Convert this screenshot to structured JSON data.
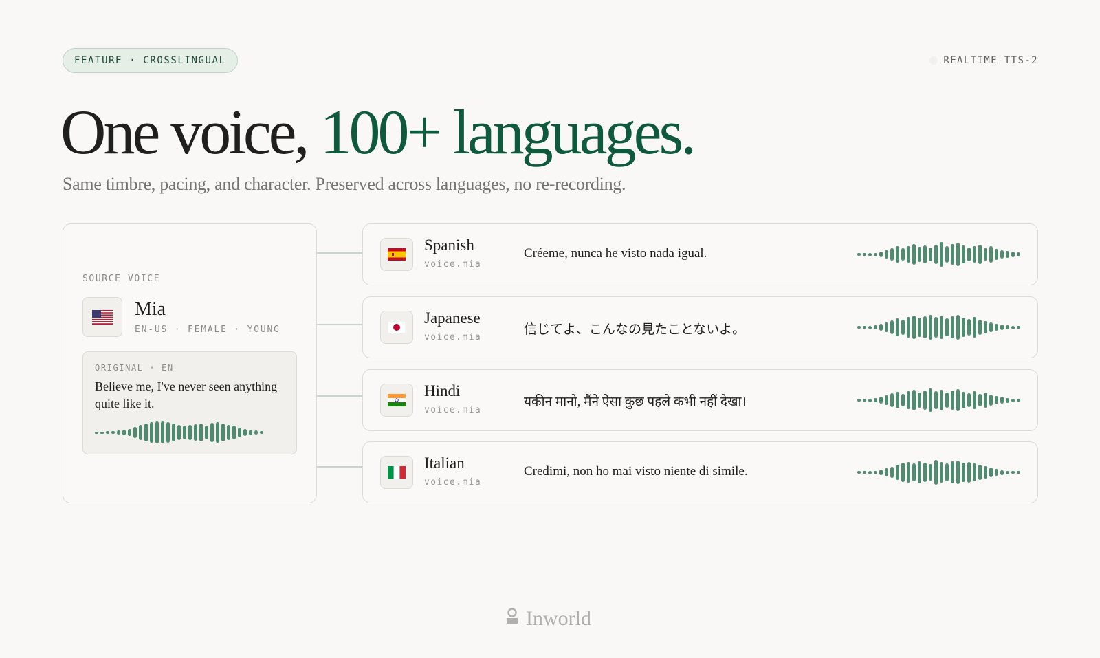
{
  "badge": "FEATURE · CROSSLINGUAL",
  "model_tag": "REALTIME TTS-2",
  "headline": {
    "part1": "One voice,",
    "part2": "100+ languages."
  },
  "subhead": "Same timbre, pacing, and character. Preserved across languages, no re-recording.",
  "source": {
    "label": "SOURCE VOICE",
    "flag_icon": "us-flag-icon",
    "name": "Mia",
    "meta": "EN-US · FEMALE · YOUNG",
    "original_label": "ORIGINAL · EN",
    "original_text": "Believe me, I've never seen anything quite like it."
  },
  "languages": [
    {
      "name": "Spanish",
      "voice": "voice.mia",
      "flag_icon": "spain-flag-icon",
      "phrase": "Créeme, nunca he visto nada igual."
    },
    {
      "name": "Japanese",
      "voice": "voice.mia",
      "flag_icon": "japan-flag-icon",
      "phrase": "信じてよ、こんなの見たことないよ。"
    },
    {
      "name": "Hindi",
      "voice": "voice.mia",
      "flag_icon": "india-flag-icon",
      "phrase": "यकीन मानो, मैंने ऐसा कुछ पहले कभी नहीं देखा।"
    },
    {
      "name": "Italian",
      "voice": "voice.mia",
      "flag_icon": "italy-flag-icon",
      "phrase": "Credimi, non ho mai visto niente di simile."
    }
  ],
  "brand": {
    "name": "Inworld",
    "icon": "inworld-logo-icon"
  },
  "colors": {
    "accent": "#0f5a3c",
    "waveform": "#4f8c6f",
    "connector": "#c6d6cc",
    "background": "#f9f8f6"
  }
}
